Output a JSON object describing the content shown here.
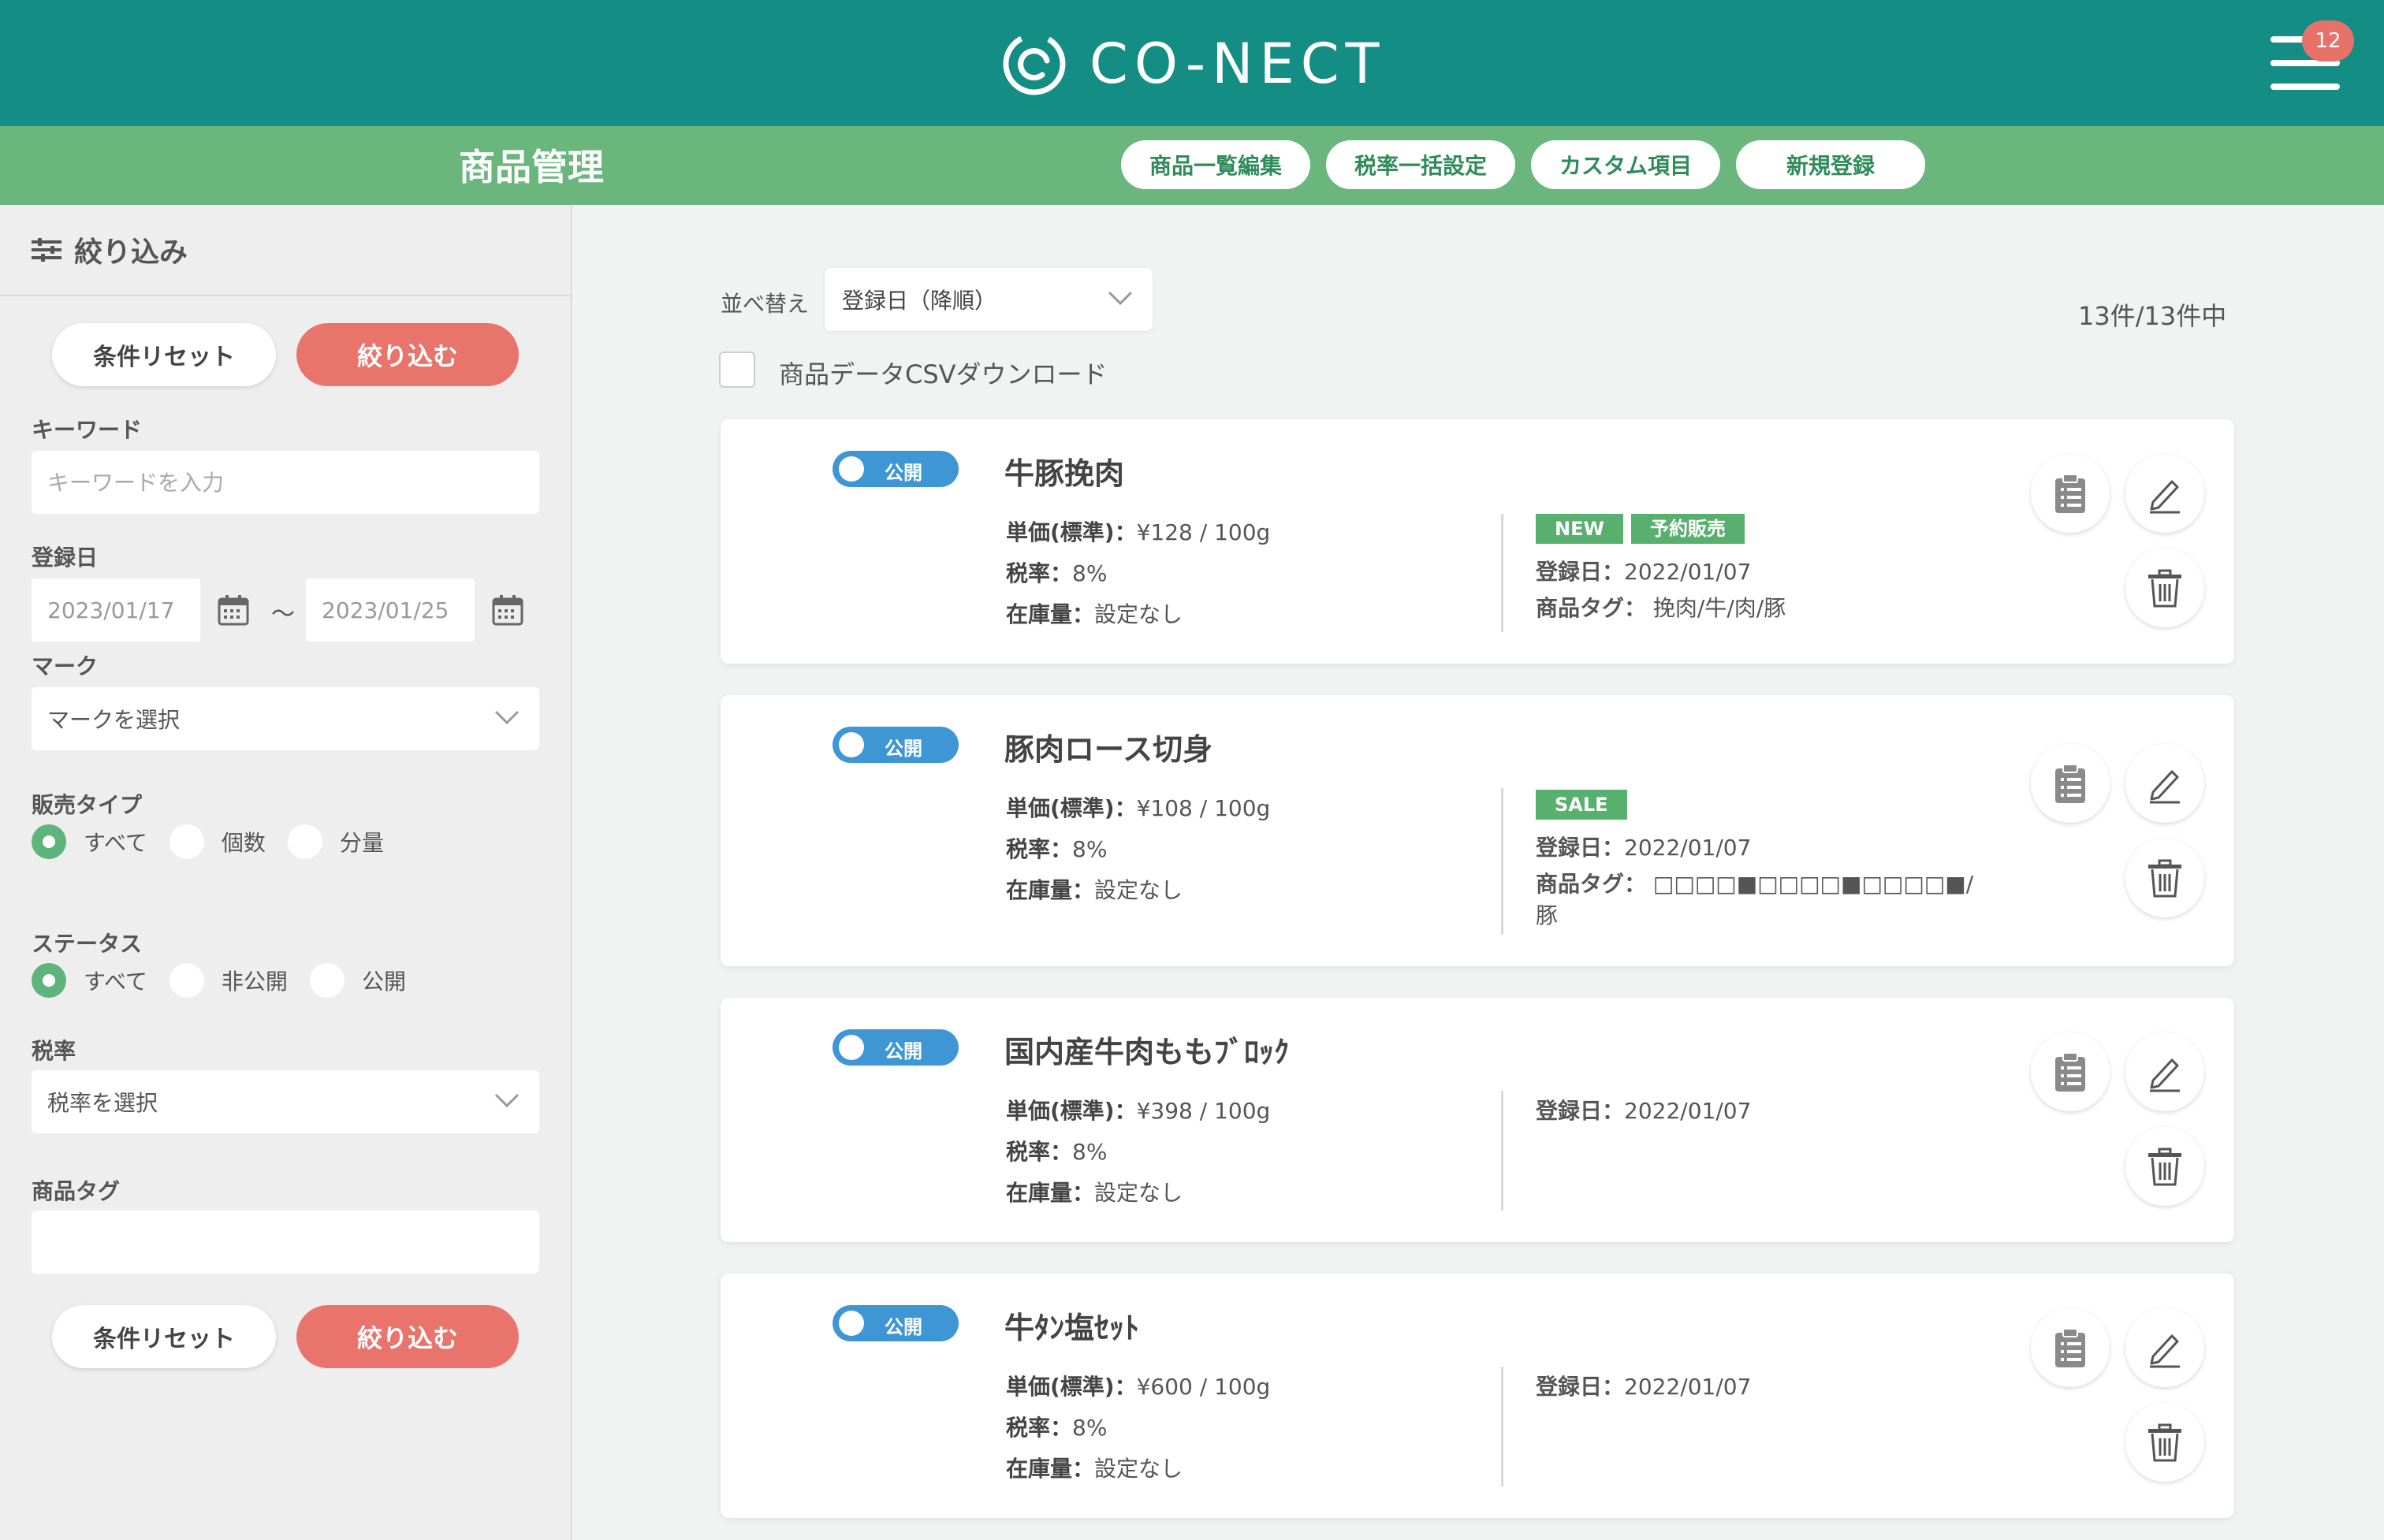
{
  "header": {
    "logo_text": "CO-NECT",
    "notification_count": "12",
    "logo_color": "#148e84"
  },
  "subheader": {
    "title": "商品管理",
    "buttons": [
      "商品一覧編集",
      "税率一括設定",
      "カスタム項目",
      "新規登録"
    ]
  },
  "sidebar": {
    "title": "絞り込み",
    "reset_label": "条件リセット",
    "apply_label": "絞り込む",
    "keyword": {
      "label": "キーワード",
      "placeholder": "キーワードを入力"
    },
    "date": {
      "label": "登録日",
      "from": "2023/01/17",
      "separator": "〜",
      "to": "2023/01/25"
    },
    "mark": {
      "label": "マーク",
      "value": "マークを選択"
    },
    "sale_type": {
      "label": "販売タイプ",
      "options": [
        "すべて",
        "個数",
        "分量"
      ],
      "selected": 0
    },
    "status": {
      "label": "ステータス",
      "options": [
        "すべて",
        "非公開",
        "公開"
      ],
      "selected": 0
    },
    "tax": {
      "label": "税率",
      "value": "税率を選択"
    },
    "tag": {
      "label": "商品タグ",
      "value": ""
    }
  },
  "main": {
    "sort_label": "並べ替え",
    "sort_value": "登録日（降順）",
    "count": "13件/13件中",
    "csv_label": "商品データCSVダウンロード",
    "labels": {
      "price": "単価(標準)：",
      "tax": "税率：",
      "stock": "在庫量：",
      "date": "登録日：",
      "tags": "商品タグ："
    },
    "products": [
      {
        "status": "公開",
        "name": "牛豚挽肉",
        "price": "¥128 / 100g",
        "tax": "8%",
        "stock": "設定なし",
        "badges": [
          "NEW",
          "予約販売"
        ],
        "date": "2022/01/07",
        "tags": " 挽肉/牛/肉/豚"
      },
      {
        "status": "公開",
        "name": "豚肉ロース切身",
        "price": "¥108 / 100g",
        "tax": "8%",
        "stock": "設定なし",
        "badges": [
          "SALE"
        ],
        "date": "2022/01/07",
        "tags": " □□□□■□□□□■□□□□■/豚"
      },
      {
        "status": "公開",
        "name": "国内産牛肉ももﾌﾞﾛｯｸ",
        "price": "¥398 / 100g",
        "tax": "8%",
        "stock": "設定なし",
        "badges": [],
        "date": "2022/01/07",
        "tags": ""
      },
      {
        "status": "公開",
        "name": "牛ﾀﾝ塩ｾｯﾄ",
        "price": "¥600 / 100g",
        "tax": "8%",
        "stock": "設定なし",
        "badges": [],
        "date": "2022/01/07",
        "tags": ""
      }
    ]
  },
  "icons": [
    "logo-icon",
    "menu-icon",
    "filter-icon",
    "calendar-icon",
    "chevron-down-icon",
    "clipboard-icon",
    "edit-icon",
    "trash-icon"
  ]
}
